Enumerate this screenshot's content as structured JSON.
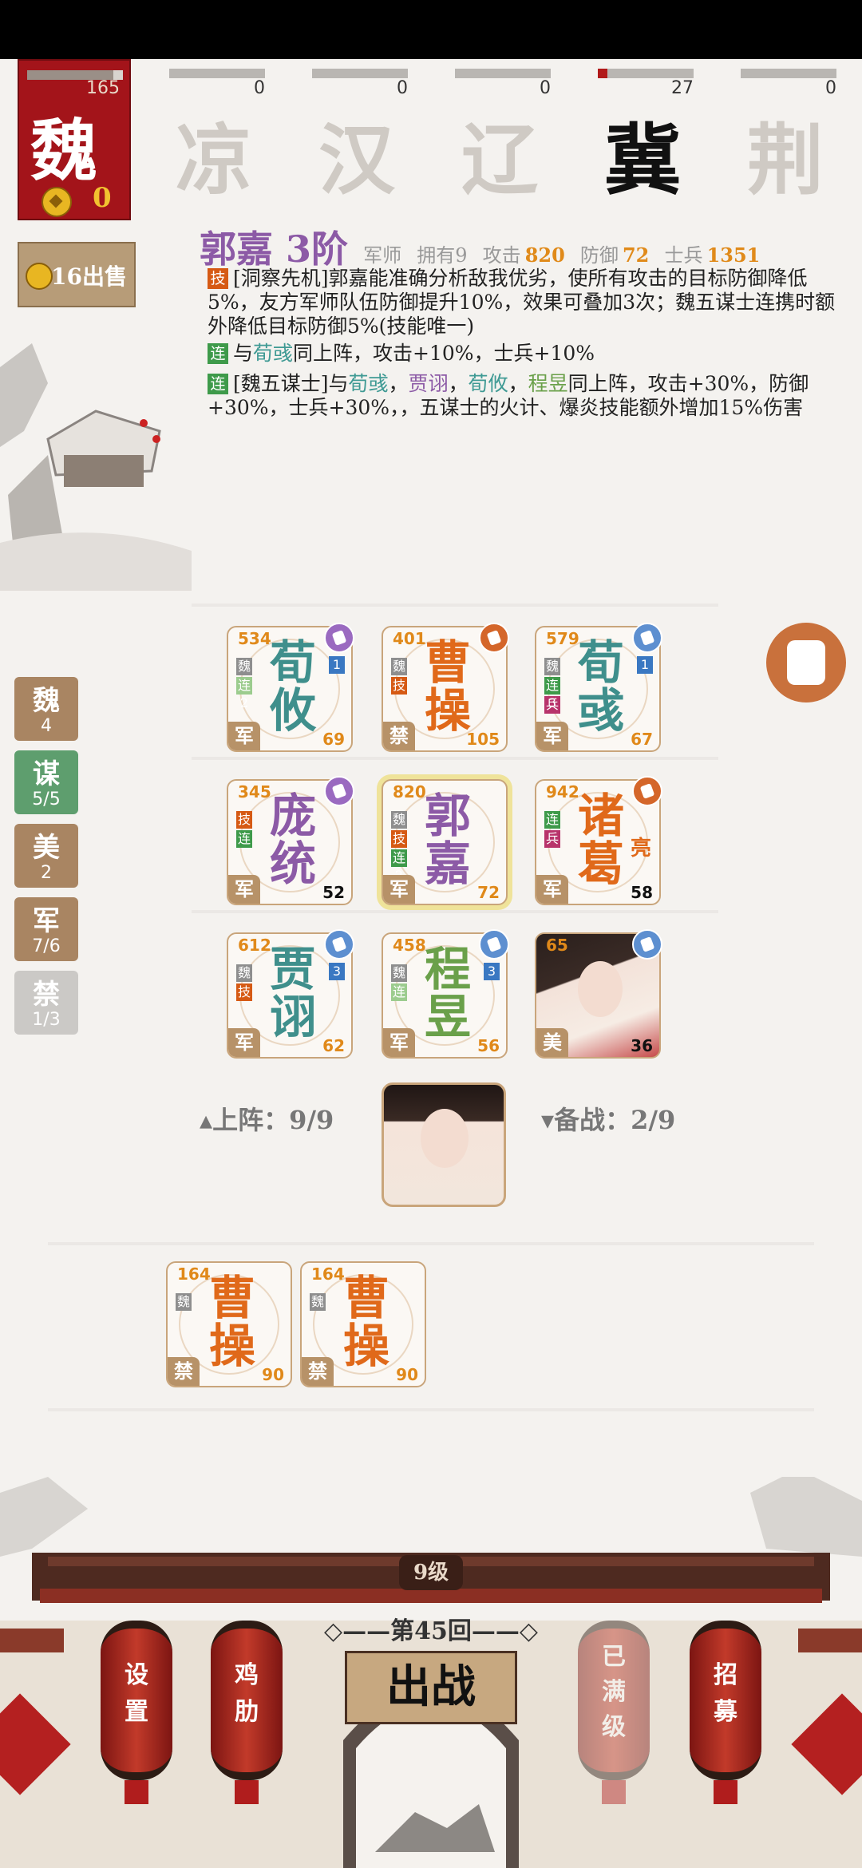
{
  "faction": {
    "name": "魏",
    "score": "165",
    "gold": "0"
  },
  "kingdoms": [
    {
      "name": "凉",
      "score": "0",
      "progress": 0
    },
    {
      "name": "汉",
      "score": "0",
      "progress": 0
    },
    {
      "name": "辽",
      "score": "0",
      "progress": 0
    },
    {
      "name": "冀",
      "score": "27",
      "progress": 0.1
    },
    {
      "name": "荆",
      "score": "0",
      "progress": 0
    }
  ],
  "sell_label": "16出售",
  "hero": {
    "name": "郭嘉 3阶",
    "role": "军师",
    "own_label": "拥有9",
    "atk_label": "攻击",
    "atk": "820",
    "def_label": "防御",
    "def": "72",
    "troops_label": "士兵",
    "troops": "1351"
  },
  "skills": {
    "s1_tag": "技",
    "s1_text": "[洞察先机]郭嘉能准确分析敌我优劣，使所有攻击的目标防御降低5%，友方军师队伍防御提升10%，效果可叠加3次；魏五谋士连携时额外降低目标防御5%(技能唯一)",
    "s2_tag": "连",
    "s2_a": "与",
    "s2_b": "荀彧",
    "s2_c": "同上阵，攻击+10%，士兵+10%",
    "s3_tag": "连",
    "s3_a": "[魏五谋士]与",
    "s3_b": "荀彧",
    "s3_c": "，",
    "s3_d": "贾诩",
    "s3_e": "，",
    "s3_f": "荀攸",
    "s3_g": "，",
    "s3_h": "程昱",
    "s3_i": "同上阵，攻击+30%，防御+30%，士兵+30%，，五谋士的火计、爆炎技能额外增加15%伤害"
  },
  "categories": [
    {
      "name": "魏",
      "count": "4",
      "color": "#a98562"
    },
    {
      "name": "谋",
      "count": "5/5",
      "color": "#5e9e6e"
    },
    {
      "name": "美",
      "count": "2",
      "color": "#a98562"
    },
    {
      "name": "军",
      "count": "7/6",
      "color": "#a98562"
    },
    {
      "name": "禁",
      "count": "1/3",
      "color": "#cbc9c6"
    }
  ],
  "cards": [
    {
      "power": "534",
      "name1": "荀",
      "name2": "攸",
      "badge": "军",
      "level": "69",
      "rank": "1",
      "tags": [
        "魏",
        "连2"
      ]
    },
    {
      "power": "401",
      "name1": "曹",
      "name2": "操",
      "badge": "禁",
      "level": "105",
      "tags": [
        "魏",
        "技"
      ]
    },
    {
      "power": "579",
      "name1": "荀",
      "name2": "彧",
      "badge": "军",
      "level": "67",
      "rank": "1",
      "tags": [
        "魏",
        "连3",
        "兵"
      ]
    },
    {
      "power": "345",
      "name1": "庞",
      "name2": "统",
      "badge": "军",
      "level": "52",
      "tags": [
        "技",
        "连"
      ]
    },
    {
      "power": "820",
      "name1": "郭",
      "name2": "嘉",
      "badge": "军",
      "level": "72",
      "tags": [
        "魏",
        "技",
        "连2"
      ]
    },
    {
      "power": "942",
      "name1": "诸",
      "name2": "葛",
      "name3": "亮",
      "badge": "军",
      "level": "58",
      "tags": [
        "连",
        "兵"
      ]
    },
    {
      "power": "612",
      "name1": "贾",
      "name2": "诩",
      "badge": "军",
      "level": "62",
      "rank": "3",
      "tags": [
        "魏",
        "技"
      ]
    },
    {
      "power": "458",
      "name1": "程",
      "name2": "昱",
      "badge": "军",
      "level": "56",
      "rank": "3",
      "tags": [
        "魏",
        "连"
      ]
    },
    {
      "power": "65",
      "badge": "美",
      "level": "36"
    }
  ],
  "deployed_label": "上阵：9/9",
  "reserve_label": "备战：2/9",
  "reserve_cards": [
    {
      "power": "164",
      "name1": "曹",
      "name2": "操",
      "badge": "禁",
      "level": "90",
      "tags": [
        "魏"
      ]
    },
    {
      "power": "164",
      "name1": "曹",
      "name2": "操",
      "badge": "禁",
      "level": "90",
      "tags": [
        "魏"
      ]
    }
  ],
  "bottom": {
    "level": "9级",
    "round": "第45回",
    "battle": "出战",
    "settings": [
      "设",
      "置"
    ],
    "chicken": [
      "鸡",
      "肋"
    ],
    "maxed": [
      "已",
      "满",
      "级"
    ],
    "recruit": [
      "招",
      "募"
    ]
  }
}
